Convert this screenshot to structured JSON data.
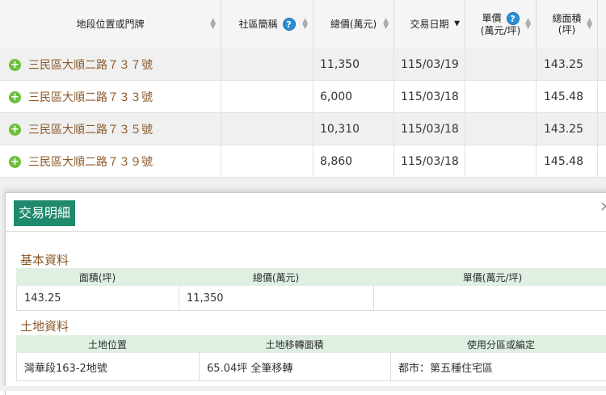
{
  "table": {
    "headers": {
      "address": "地段位置或門牌",
      "community": "社區簡稱",
      "total_price": "總價(萬元)",
      "trade_date": "交易日期",
      "unit_price_line1": "單價",
      "unit_price_line2": "(萬元/坪)",
      "area_line1": "總面積",
      "area_line2": "(坪)",
      "help_symbol": "?"
    },
    "rows": [
      {
        "address": "三民區大順二路７３７號",
        "community": "",
        "total_price": "11,350",
        "date": "115/03/19",
        "unit_price": "",
        "area": "143.25"
      },
      {
        "address": "三民區大順二路７３３號",
        "community": "",
        "total_price": "6,000",
        "date": "115/03/18",
        "unit_price": "",
        "area": "145.48"
      },
      {
        "address": "三民區大順二路７３５號",
        "community": "",
        "total_price": "10,310",
        "date": "115/03/18",
        "unit_price": "",
        "area": "143.25"
      },
      {
        "address": "三民區大順二路７３９號",
        "community": "",
        "total_price": "8,860",
        "date": "115/03/18",
        "unit_price": "",
        "area": "145.48"
      }
    ]
  },
  "detail": {
    "title": "交易明細",
    "close_symbol": "×",
    "basic": {
      "section": "基本資料",
      "headers": [
        "面積(坪)",
        "總價(萬元)",
        "單價(萬元/坪)"
      ],
      "values": [
        "143.25",
        "11,350",
        ""
      ]
    },
    "land": {
      "section": "土地資料",
      "headers": [
        "土地位置",
        "土地移轉面積",
        "使用分區或編定"
      ],
      "values": [
        "灣華段163-2地號",
        "65.04坪 全筆移轉",
        "都市：第五種住宅區"
      ]
    }
  },
  "colors": {
    "accent": "#1f8a6d",
    "section_text": "#8a5a2b",
    "table_header_bg": "#dff0e3",
    "help_icon": "#2a8fd6",
    "plus_icon": "#6cbf3a"
  }
}
